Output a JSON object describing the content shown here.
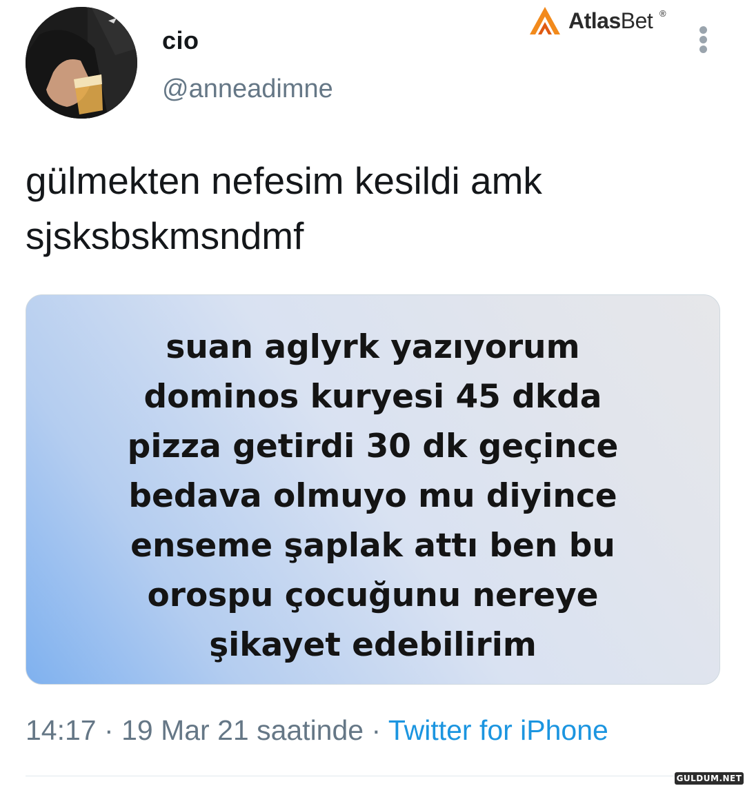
{
  "user": {
    "display_name": "cio",
    "handle": "@anneadimne"
  },
  "brand": {
    "name_bold": "Atlas",
    "name_light": "Bet",
    "registered_mark": "®"
  },
  "tweet": {
    "text_lines": [
      "gülmekten nefesim kesildi amk",
      "sjsksbskmsndmf"
    ]
  },
  "media": {
    "lines": [
      "suan aglyrk yazıyorum",
      "dominos kuryesi  45 dkda",
      "pizza getirdi 30 dk geçince",
      "bedava olmuyo mu diyince",
      "enseme şaplak attı ben bu",
      "orospu çocuğunu nereye",
      "şikayet edebilirim"
    ]
  },
  "meta": {
    "time": "14:17",
    "separator": "·",
    "date": "19 Mar 21 saatinde",
    "source": "Twitter for iPhone"
  },
  "watermark": {
    "site": "GULDUM.NET"
  },
  "colors": {
    "link": "#1b95e0",
    "secondary_text": "#657786",
    "primary_text": "#14171a",
    "brand_orange": "#f28a1c"
  },
  "icons": {
    "more": "vertical-ellipsis-icon",
    "brand": "atlasbet-logo-icon"
  }
}
